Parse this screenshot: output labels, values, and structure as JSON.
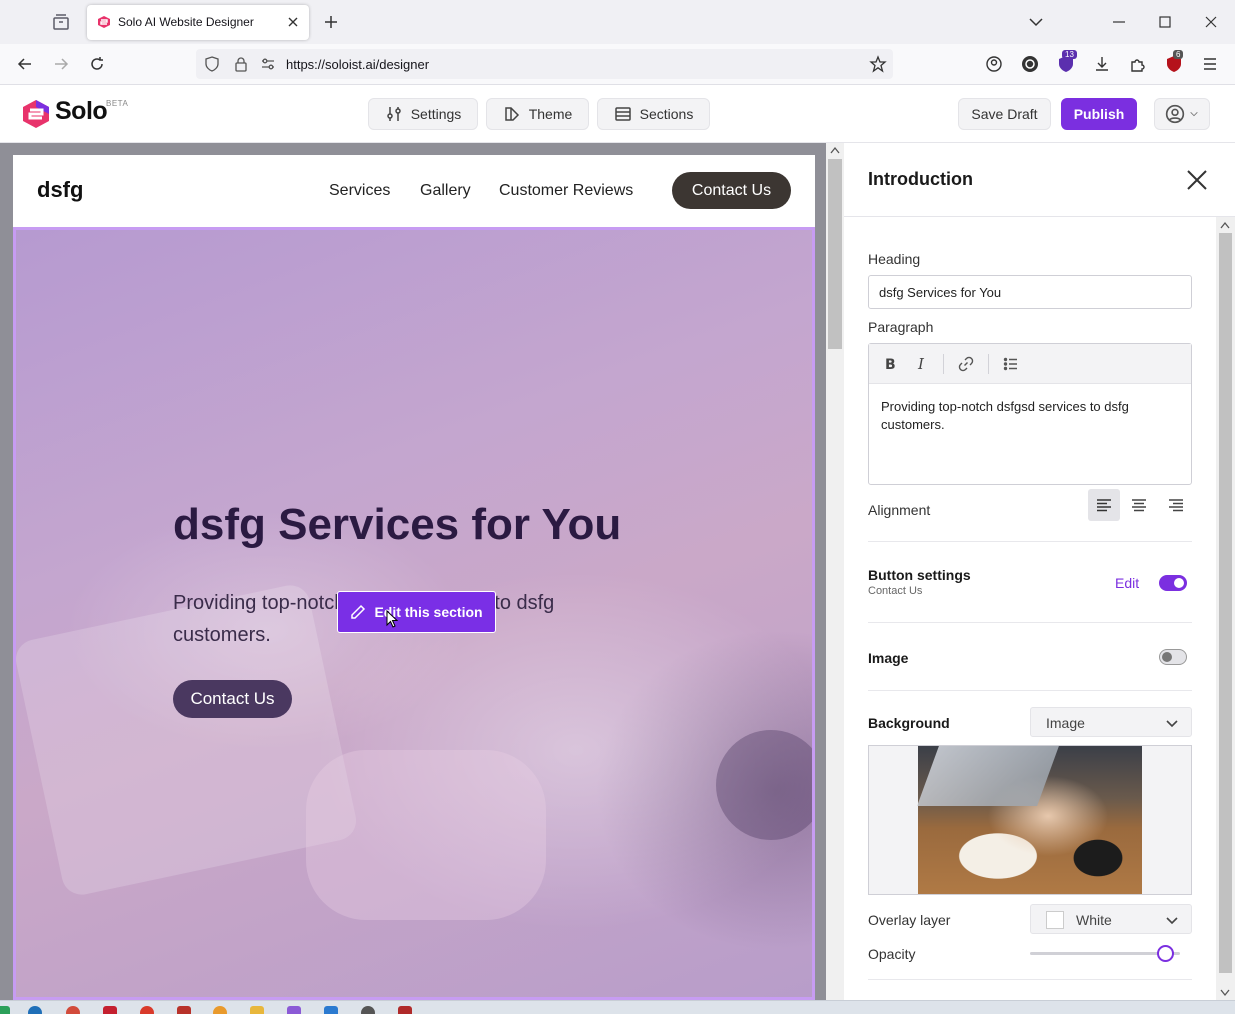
{
  "browser": {
    "tab_title": "Solo AI Website Designer",
    "url": "https://soloist.ai/designer",
    "extension_badge_1": "13",
    "extension_badge_2": "6"
  },
  "app": {
    "logo": "Solo",
    "beta": "BETA",
    "settings_label": "Settings",
    "theme_label": "Theme",
    "sections_label": "Sections",
    "save_draft_label": "Save Draft",
    "publish_label": "Publish"
  },
  "site": {
    "brand": "dsfg",
    "nav": [
      "Services",
      "Gallery",
      "Customer Reviews"
    ],
    "nav_cta": "Contact Us",
    "hero_title": "dsfg Services for You",
    "hero_paragraph": "Providing top-notch dsfgsd services to dsfg customers.",
    "hero_button": "Contact Us",
    "edit_section_label": "Edit this section"
  },
  "panel": {
    "title": "Introduction",
    "heading_label": "Heading",
    "heading_value": "dsfg Services for You",
    "paragraph_label": "Paragraph",
    "paragraph_value": "Providing top-notch dsfgsd services to dsfg customers.",
    "alignment_label": "Alignment",
    "alignment_selected": "left",
    "button_settings_label": "Button settings",
    "button_settings_sub": "Contact Us",
    "edit_label": "Edit",
    "button_toggle": true,
    "image_label": "Image",
    "image_toggle": false,
    "background_label": "Background",
    "background_value": "Image",
    "overlay_label": "Overlay layer",
    "overlay_value": "White",
    "opacity_label": "Opacity",
    "opacity_value": 0.9
  },
  "colors": {
    "accent": "#7b2fe0",
    "nav_cta_bg": "#3c3632",
    "hero_overlay": "#c79cf2"
  }
}
